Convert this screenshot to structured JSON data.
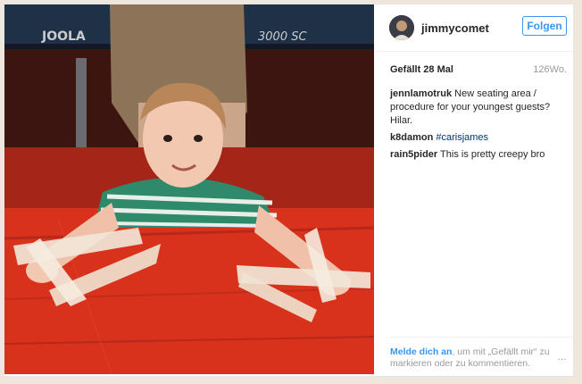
{
  "post": {
    "username": "jimmycomet",
    "follow_label": "Folgen",
    "likes": "Gefällt 28 Mal",
    "age": "126Wo.",
    "photo_caption": "Child with arms taped to a red table",
    "table_brand_left": "JOOLA",
    "table_brand_right": "3000 SC"
  },
  "comments": [
    {
      "user": "jennlamotruk",
      "text": "New seating area / procedure for your youngest guests? Hilar."
    },
    {
      "user": "k8damon",
      "tag": "#carisjames"
    },
    {
      "user": "rain5pider",
      "text": "This is pretty creepy bro"
    }
  ],
  "footer": {
    "login_link": "Melde dich an",
    "login_rest": ", um mit „Gefällt mir“ zu markieren oder zu kommentieren.",
    "more_label": "…"
  },
  "colors": {
    "link_blue": "#3897f0",
    "hashtag_blue": "#003569",
    "table_red": "#d8321d"
  },
  "icons": [
    "avatar-photo",
    "more-options-icon"
  ]
}
